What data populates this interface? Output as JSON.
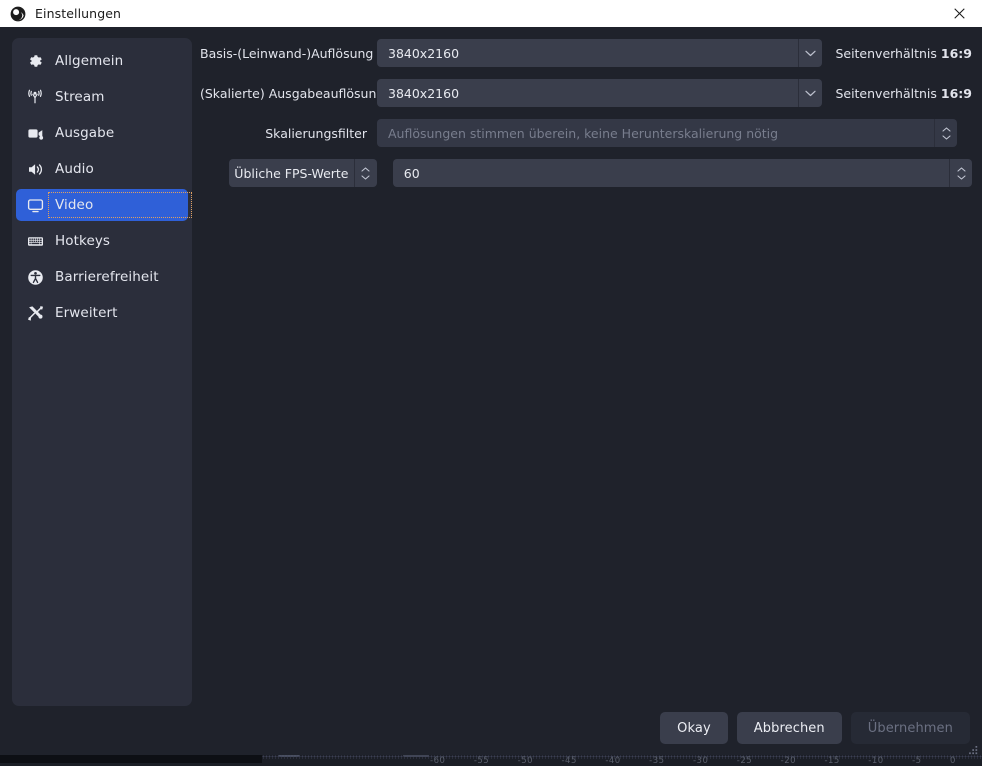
{
  "window": {
    "title": "Einstellungen",
    "app_icon": "obs-logo-icon",
    "close_icon": "close-icon"
  },
  "sidebar": {
    "items": [
      {
        "label": "Allgemein",
        "icon": "gear-icon",
        "selected": false
      },
      {
        "label": "Stream",
        "icon": "broadcast-icon",
        "selected": false
      },
      {
        "label": "Ausgabe",
        "icon": "video-camera-icon",
        "selected": false
      },
      {
        "label": "Audio",
        "icon": "speaker-icon",
        "selected": false
      },
      {
        "label": "Video",
        "icon": "monitor-icon",
        "selected": true
      },
      {
        "label": "Hotkeys",
        "icon": "keyboard-icon",
        "selected": false
      },
      {
        "label": "Barrierefreiheit",
        "icon": "accessibility-icon",
        "selected": false
      },
      {
        "label": "Erweitert",
        "icon": "tools-icon",
        "selected": false
      }
    ]
  },
  "video_settings": {
    "base_resolution": {
      "label": "Basis-(Leinwand-)Auflösung",
      "value": "3840x2160",
      "aspect_prefix": "Seitenverhältnis",
      "aspect_value": "16:9"
    },
    "output_resolution": {
      "label": "(Skalierte) Ausgabeauflösung",
      "value": "3840x2160",
      "aspect_prefix": "Seitenverhältnis",
      "aspect_value": "16:9"
    },
    "downscale_filter": {
      "label": "Skalierungsfilter",
      "value": "Auflösungen stimmen überein, keine Herunterskalierung nötig",
      "disabled": true
    },
    "fps": {
      "type_label": "Übliche FPS-Werte",
      "value": "60"
    }
  },
  "buttons": {
    "ok": "Okay",
    "cancel": "Abbrechen",
    "apply": "Übernehmen"
  },
  "background": {
    "mixer_scale": [
      "-60",
      "-55",
      "-50",
      "-45",
      "-40",
      "-35",
      "-30",
      "-25",
      "-20",
      "-15",
      "-10",
      "-5",
      "0"
    ]
  },
  "colors": {
    "accent_blue": "#2f60d8",
    "focus_outline": "#e0a060",
    "dialog_bg": "#1f222b",
    "sidebar_bg": "#2b2e3b",
    "input_bg": "#3a3e4c",
    "titlebar_bg": "#ffffff"
  }
}
